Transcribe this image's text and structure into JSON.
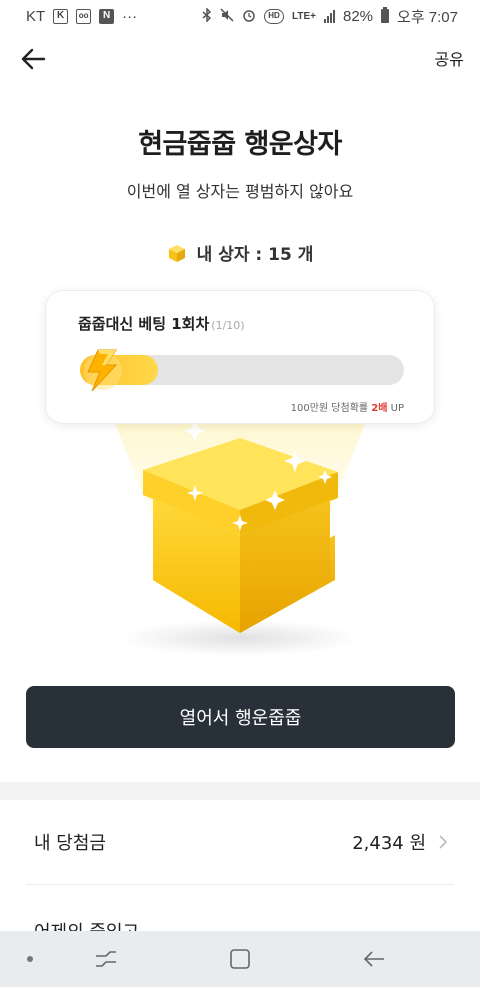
{
  "status_bar": {
    "carrier": "KT",
    "left_icons": [
      "k-icon",
      "vr-icon",
      "n-icon"
    ],
    "more": "···",
    "network": "LTE+",
    "hd": "HD",
    "battery": "82%",
    "time": "오후 7:07"
  },
  "header": {
    "share_label": "공유"
  },
  "main": {
    "title": "현금줍줍 행운상자",
    "subtitle": "이번에 열 상자는 평범하지 않아요",
    "box_count_label": "내 상자 : 15 개"
  },
  "bet_card": {
    "title": "줍줍대신 베팅 1회차",
    "progress_text": "(1/10)",
    "progress_fraction": 0.1,
    "note_prefix": "100만원 당첨확률 ",
    "note_highlight": "2배",
    "note_suffix": " UP"
  },
  "open_button": {
    "label": "열어서 행운줍줍"
  },
  "winnings": {
    "label": "내 당첨금",
    "value": "2,434 원"
  },
  "partial_row": {
    "label": "어제의 줍입고"
  },
  "colors": {
    "accent_yellow": "#ffc12b",
    "button_dark": "#283039",
    "highlight_red": "#e53935"
  }
}
